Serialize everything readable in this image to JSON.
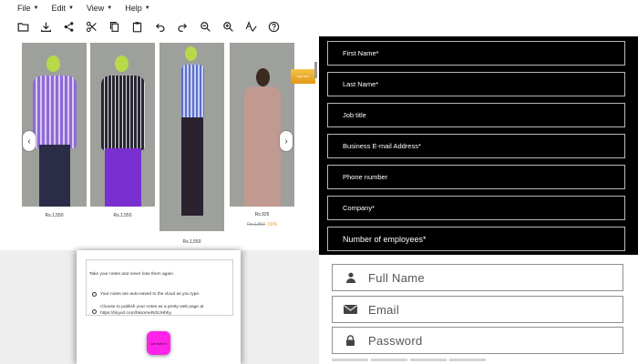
{
  "menubar": {
    "items": [
      {
        "label": "File"
      },
      {
        "label": "Edit"
      },
      {
        "label": "View"
      },
      {
        "label": "Help"
      }
    ]
  },
  "toolbar": {
    "buttons": [
      {
        "icon": "folder-open-icon"
      },
      {
        "icon": "download-icon"
      },
      {
        "icon": "share-icon"
      },
      {
        "icon": "cut-icon"
      },
      {
        "icon": "copy-icon"
      },
      {
        "icon": "paste-icon"
      },
      {
        "icon": "undo-icon"
      },
      {
        "icon": "redo-icon"
      },
      {
        "icon": "zoom-out-icon"
      },
      {
        "icon": "zoom-in-icon"
      },
      {
        "icon": "spellcheck-icon"
      },
      {
        "icon": "help-icon"
      }
    ]
  },
  "products": {
    "items": [
      {
        "price": "Rs.1,550",
        "shirt_color": "#7b5cc4"
      },
      {
        "price": "Rs.1,550",
        "shirt_color": "#3a3042"
      },
      {
        "price": "Rs.1,550",
        "shirt_color": "#6b7fd1"
      },
      {
        "price": "Rs.925",
        "old_price": "Rs.1,850",
        "discount": "-50%",
        "shirt_color": "#b98f86"
      }
    ],
    "prev_arrow": "‹",
    "next_arrow": "›",
    "sale_tag": "Sale 50%"
  },
  "dark_form": {
    "fields": [
      {
        "label": "First Name*"
      },
      {
        "label": "Last Name*"
      },
      {
        "label": "Job title"
      },
      {
        "label": "Business E-mail Address*"
      },
      {
        "label": "Phone number"
      },
      {
        "label": "Company*"
      },
      {
        "label": "Number of employees*"
      }
    ]
  },
  "notes": {
    "intro": "Take your notes and never lose them again.",
    "line1": "Your notes are auto-saved to the cloud as you type.",
    "line2a": "Choose to publish your notes as a pretty web page at",
    "line2b": "https://tinyurl.com/hksomeRdzJHbhy.",
    "button": "Let me in!"
  },
  "login": {
    "full_name_placeholder": "Full Name",
    "email_placeholder": "Email",
    "password_placeholder": "Password"
  }
}
